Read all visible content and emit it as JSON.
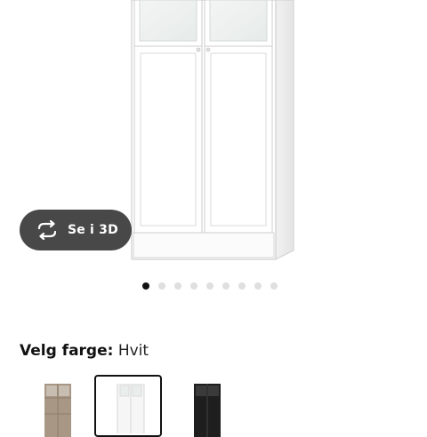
{
  "product": {
    "image_alt": "Bookcase with glass and panel doors, white",
    "carousel": {
      "count": 9,
      "active_index": 0
    }
  },
  "view_3d": {
    "label": "Se i 3D",
    "icon": "rotate-3d-icon"
  },
  "color_picker": {
    "heading_label": "Velg farge:",
    "selected_value": "Hvit",
    "options": [
      {
        "name": "white-stained-oak",
        "color": "#a89784",
        "selected": false
      },
      {
        "name": "white",
        "color": "#f4f4f4",
        "selected": true
      },
      {
        "name": "black-brown",
        "color": "#1e1e1e",
        "selected": false
      }
    ]
  },
  "colors": {
    "button_bg": "#484848",
    "dot_active": "#111111",
    "dot_inactive": "#dfdfdf",
    "frame_white": "#ffffff",
    "glass": "#eef2f1"
  }
}
